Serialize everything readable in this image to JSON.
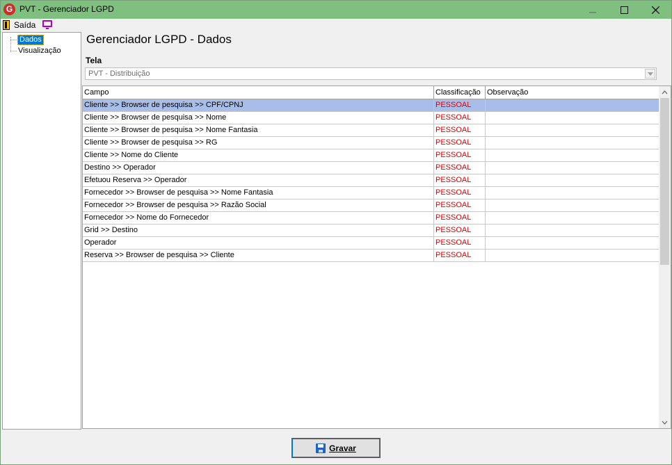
{
  "window": {
    "title": "PVT - Gerenciador LGPD",
    "app_icon_letter": "G"
  },
  "menu": {
    "saida_label": "Saída"
  },
  "tree": {
    "items": [
      {
        "label": "Dados",
        "selected": true
      },
      {
        "label": "Visualização",
        "selected": false
      }
    ]
  },
  "main": {
    "title": "Gerenciador LGPD - Dados",
    "tela_label": "Tela",
    "tela_value": "PVT - Distribuição"
  },
  "grid": {
    "headers": [
      "Campo",
      "Classificação",
      "Observação"
    ],
    "rows": [
      {
        "campo": "Cliente >> Browser de pesquisa >> CPF/CPNJ",
        "classificacao": "PESSOAL",
        "observacao": ""
      },
      {
        "campo": "Cliente >> Browser de pesquisa >> Nome",
        "classificacao": "PESSOAL",
        "observacao": ""
      },
      {
        "campo": "Cliente >> Browser de pesquisa >> Nome Fantasia",
        "classificacao": "PESSOAL",
        "observacao": ""
      },
      {
        "campo": "Cliente >> Browser de pesquisa >> RG",
        "classificacao": "PESSOAL",
        "observacao": ""
      },
      {
        "campo": "Cliente >> Nome do Cliente",
        "classificacao": "PESSOAL",
        "observacao": ""
      },
      {
        "campo": "Destino >> Operador",
        "classificacao": "PESSOAL",
        "observacao": ""
      },
      {
        "campo": "Efetuou Reserva >> Operador",
        "classificacao": "PESSOAL",
        "observacao": ""
      },
      {
        "campo": "Fornecedor >> Browser de pesquisa >> Nome Fantasia",
        "classificacao": "PESSOAL",
        "observacao": ""
      },
      {
        "campo": "Fornecedor >> Browser de pesquisa >> Razão Social",
        "classificacao": "PESSOAL",
        "observacao": ""
      },
      {
        "campo": "Fornecedor >> Nome do Fornecedor",
        "classificacao": "PESSOAL",
        "observacao": ""
      },
      {
        "campo": "Grid >> Destino",
        "classificacao": "PESSOAL",
        "observacao": ""
      },
      {
        "campo": "Operador",
        "classificacao": "PESSOAL",
        "observacao": ""
      },
      {
        "campo": "Reserva >> Browser de pesquisa >> Cliente",
        "classificacao": "PESSOAL",
        "observacao": ""
      }
    ],
    "selected_row": 0
  },
  "footer": {
    "save_label": "Gravar"
  },
  "colors": {
    "titlebar": "#7fbf7f",
    "selection": "#a8bde8",
    "classification_text": "#e00000",
    "tree_selection": "#0078d7"
  }
}
